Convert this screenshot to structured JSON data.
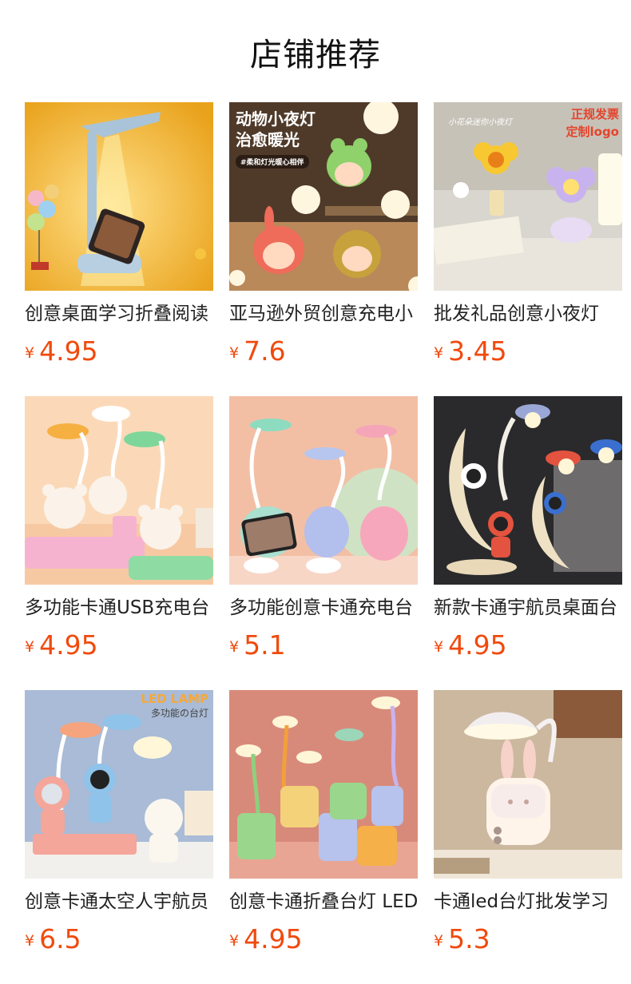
{
  "header": {
    "title": "店铺推荐"
  },
  "currency_symbol": "¥",
  "products": [
    {
      "name": "创意桌面学习折叠阅读",
      "price": "4.95",
      "image_icon": "desk-lamp-icon"
    },
    {
      "name": "亚马逊外贸创意充电小",
      "price": "7.6",
      "image_icon": "animal-night-light-icon",
      "overlay": {
        "line1": "动物小夜灯",
        "line2": "治愈暖光",
        "tag": "#柔和灯光暖心相伴"
      }
    },
    {
      "name": "批发礼品创意小夜灯",
      "price": "3.45",
      "image_icon": "flower-night-light-icon",
      "overlay": {
        "line1": "正规发票",
        "line2": "定制logo",
        "script": "小花朵迷你小夜灯"
      }
    },
    {
      "name": "多功能卡通USB充电台",
      "price": "4.95",
      "image_icon": "bear-lamp-icon"
    },
    {
      "name": "多功能创意卡通充电台",
      "price": "5.1",
      "image_icon": "cat-lamp-icon"
    },
    {
      "name": "新款卡通宇航员桌面台",
      "price": "4.95",
      "image_icon": "astronaut-lamp-icon"
    },
    {
      "name": "创意卡通太空人宇航员",
      "price": "6.5",
      "image_icon": "spaceman-lamp-icon",
      "overlay": {
        "line1": "LED LAMP",
        "line2": "多功能の台灯"
      }
    },
    {
      "name": "创意卡通折叠台灯 LED",
      "price": "4.95",
      "image_icon": "pig-lamp-icon"
    },
    {
      "name": "卡通led台灯批发学习",
      "price": "5.3",
      "image_icon": "rabbit-lamp-icon"
    }
  ]
}
